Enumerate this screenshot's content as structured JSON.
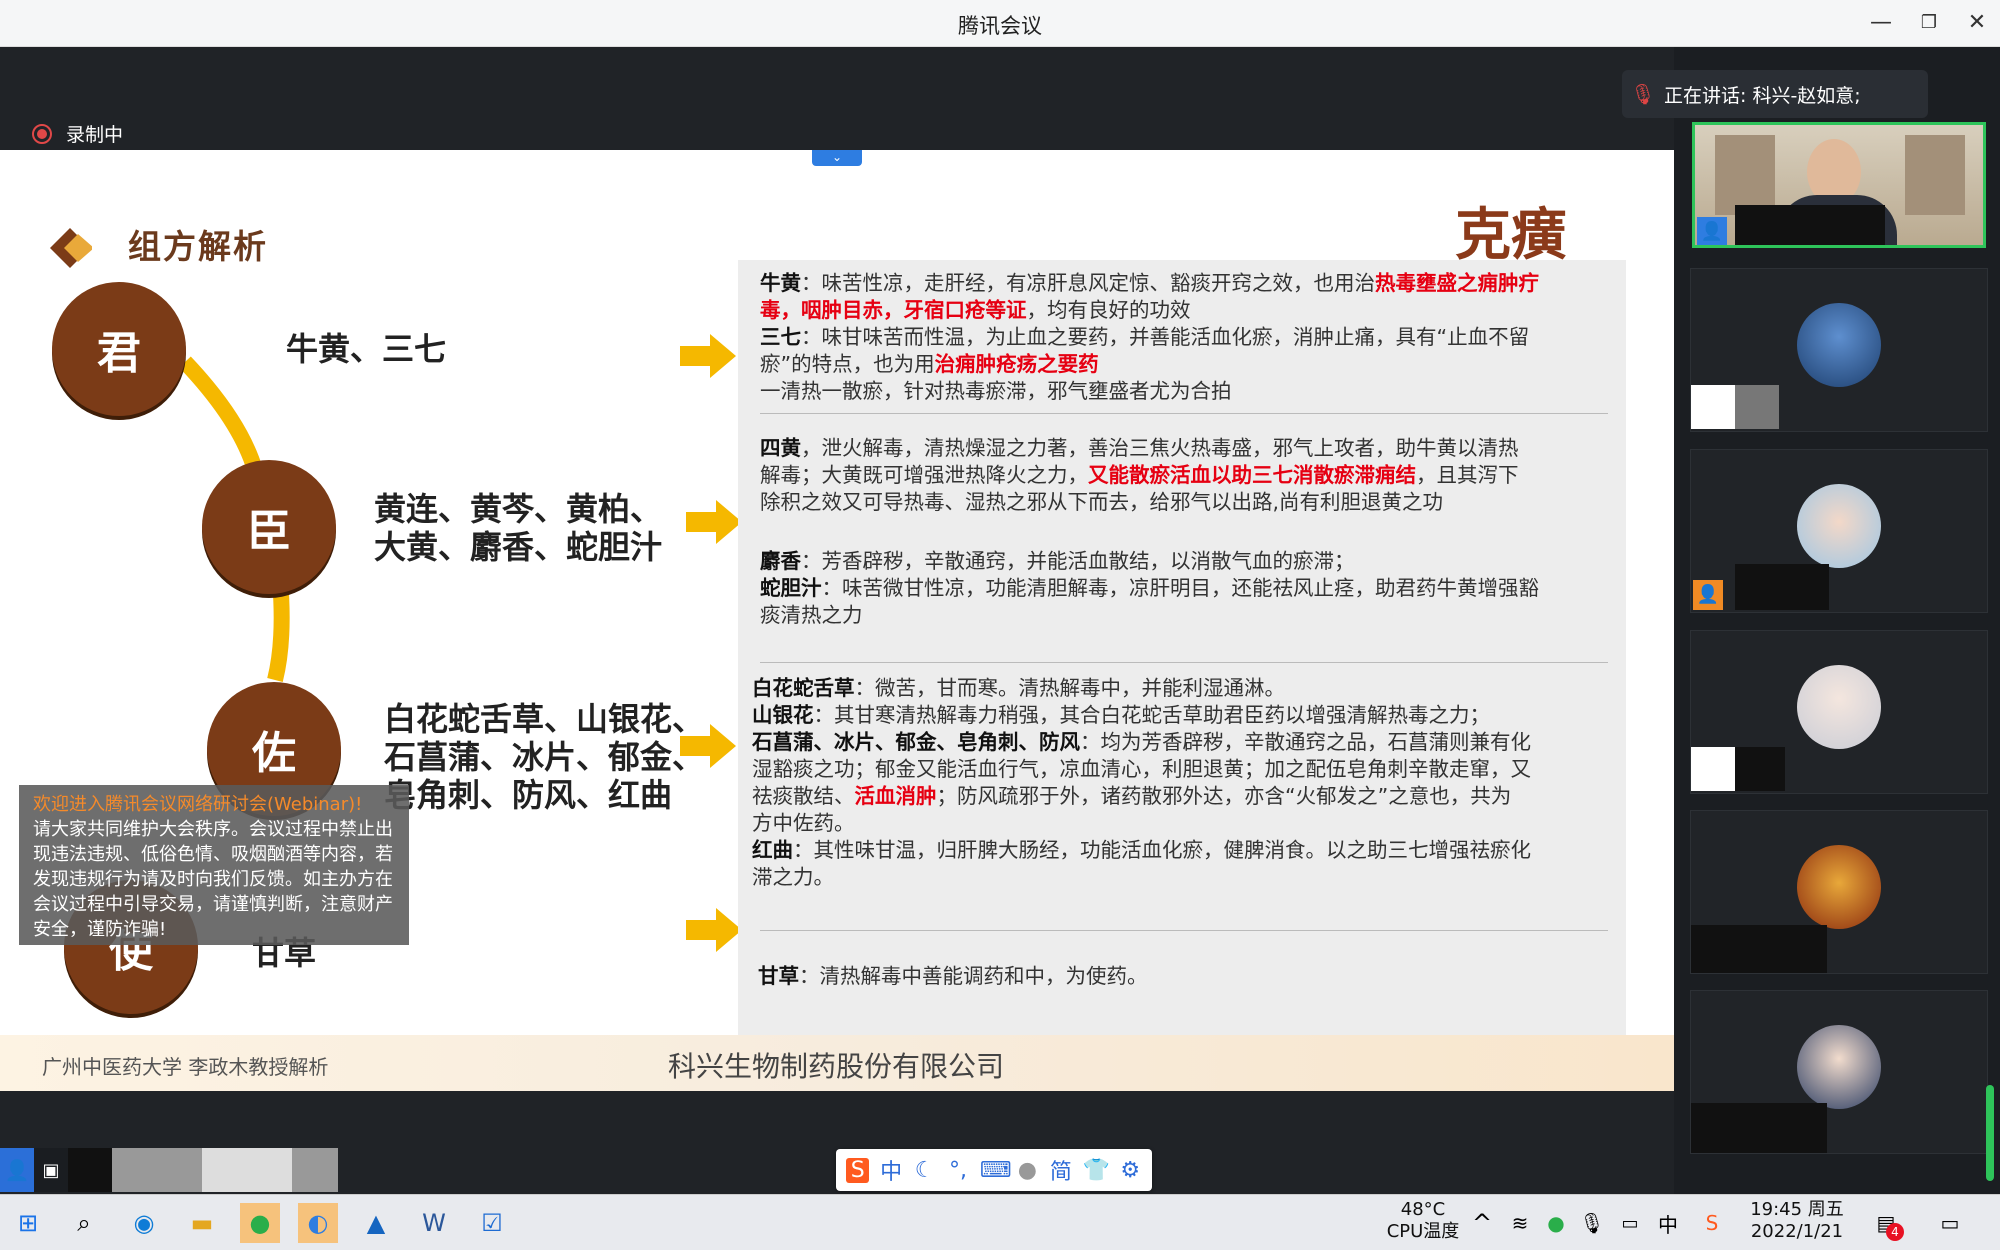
{
  "window": {
    "title": "腾讯会议"
  },
  "meeting": {
    "recording": "录制中",
    "speaking": "正在讲话: 科兴-赵如意;"
  },
  "slide": {
    "section_title": "组方解析",
    "brand": "克癀",
    "roles": [
      {
        "label": "君",
        "herbs": "牛黄、三七"
      },
      {
        "label": "臣",
        "herbs_line1": "黄连、黄芩、黄柏、",
        "herbs_line2": "大黄、麝香、蛇胆汁"
      },
      {
        "label": "佐",
        "herbs_line1": "白花蛇舌草、山银花、",
        "herbs_line2": "石菖蒲、冰片、郁金、",
        "herbs_line3": "皂角刺、防风、红曲"
      },
      {
        "label": "使",
        "herbs": "甘草"
      }
    ],
    "jun": {
      "l1_b": "牛黄",
      "l1_t": "：味苦性凉，走肝经，有凉肝息风定惊、豁痰开窍之效，也用治",
      "l1_r": "热毒壅盛之痈肿疔",
      "l2_r": "毒，咽肿目赤，牙宿口疮等证",
      "l2_t": "，均有良好的功效",
      "l3_b": "三七",
      "l3_t": "：味甘味苦而性温，为止血之要药，并善能活血化瘀，消肿止痛，具有“止血不留",
      "l4_t": "瘀”的特点，也为用",
      "l4_r": "治痈肿疮疡之要药",
      "l5_t": "一清热一散瘀，针对热毒瘀滞，邪气壅盛者尤为合拍"
    },
    "chen": {
      "l1_b": "四黄",
      "l1_t": "，泄火解毒，清热燥湿之力著，善治三焦火热毒盛，邪气上攻者，助牛黄以清热",
      "l2_t": "解毒；大黄既可增强泄热降火之力，",
      "l2_r": "又能散瘀活血以助三七消散瘀滞痈结",
      "l2_t2": "，且其泻下",
      "l3_t": "除积之效又可导热毒、湿热之邪从下而去，给邪气以出路,尚有利胆退黄之功",
      "l4_b": "麝香",
      "l4_t": "：芳香辟秽，辛散通窍，并能活血散结，以消散气血的瘀滞；",
      "l5_b": "蛇胆汁",
      "l5_t": "：味苦微甘性凉，功能清胆解毒，凉肝明目，还能祛风止痉，助君药牛黄增强豁",
      "l6_t": "痰清热之力"
    },
    "zuo": {
      "l1_b": "白花蛇舌草",
      "l1_t": "：微苦，甘而寒。清热解毒中，并能利湿通淋。",
      "l2_b": "山银花",
      "l2_t": "：其甘寒清热解毒力稍强，其合白花蛇舌草助君臣药以增强清解热毒之力；",
      "l3_b": "石菖蒲、冰片、郁金、皂角刺、防风",
      "l3_t": "：均为芳香辟秽，辛散通窍之品，石菖蒲则兼有化",
      "l4_t": "湿豁痰之功；郁金又能活血行气，凉血清心，利胆退黄；加之配伍皂角刺辛散走窜，又",
      "l5_t": "祛痰散结、",
      "l5_r": "活血消肿",
      "l5_t2": "；防风疏邪于外，诸药散邪外达，亦含“火郁发之”之意也，共为",
      "l6_t": "方中佐药。",
      "l7_b": "红曲",
      "l7_t": "：其性味甘温，归肝脾大肠经，功能活血化瘀，健脾消食。以之助三七增强祛瘀化",
      "l8_t": "滞之力。"
    },
    "shi": {
      "l1_b": "甘草",
      "l1_t": "：清热解毒中善能调药和中，为使药。"
    },
    "footer_left": "广州中医药大学 李政木教授解析",
    "footer_center": "科兴生物制药股份有限公司"
  },
  "notice": {
    "heading": "欢迎进入腾讯会议网络研讨会(Webinar)!",
    "body": "请大家共同维护大会秩序。会议过程中禁止出现违法违规、低俗色情、吸烟酗酒等内容，若发现违规行为请及时向我们反馈。如主办方在会议过程中引导交易，请谨慎判断，注意财产安全，谨防诈骗!"
  },
  "ime": {
    "lang": "中",
    "simp": "简"
  },
  "taskbar": {
    "temp": "48°C",
    "temp_label": "CPU温度",
    "tray_lang": "中",
    "time": "19:45 周五",
    "date": "2022/1/21",
    "notif_count": "4"
  },
  "colors": {
    "accent_red": "#e60012",
    "brown": "#7b3b17",
    "gold": "#f5b800",
    "speaker_border": "#2ec45a"
  }
}
